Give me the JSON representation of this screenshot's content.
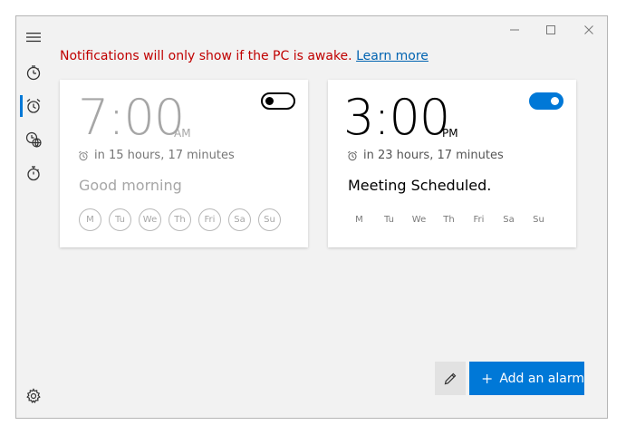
{
  "window": {
    "controls": [
      "minimize-icon",
      "maximize-icon",
      "close-icon"
    ]
  },
  "sidebar": {
    "items": [
      {
        "name": "hamburger-menu",
        "icon": "hamburger-icon"
      },
      {
        "name": "timer",
        "icon": "timer-icon"
      },
      {
        "name": "alarm",
        "icon": "alarm-clock-icon",
        "active": true
      },
      {
        "name": "world-clock",
        "icon": "world-clock-icon"
      },
      {
        "name": "stopwatch",
        "icon": "stopwatch-icon"
      },
      {
        "name": "settings",
        "icon": "gear-icon"
      }
    ]
  },
  "notice": {
    "text": "Notifications will only show if the PC is awake.",
    "link": "Learn more"
  },
  "alarms": [
    {
      "time": "7:00",
      "ampm": "AM",
      "countdown": "in 15 hours, 17 minutes",
      "name": "Good morning",
      "enabled": false,
      "days": [
        "M",
        "Tu",
        "We",
        "Th",
        "Fri",
        "Sa",
        "Su"
      ]
    },
    {
      "time": "3:00",
      "ampm": "PM",
      "countdown": "in 23 hours, 17 minutes",
      "name": "Meeting Scheduled.",
      "enabled": true,
      "days": [
        "M",
        "Tu",
        "We",
        "Th",
        "Fri",
        "Sa",
        "Su"
      ]
    }
  ],
  "footer": {
    "edit_icon": "pencil-icon",
    "add_label": "Add an alarm",
    "add_icon": "plus-icon"
  },
  "colors": {
    "accent": "#0078d7",
    "notice": "#c00000",
    "link": "#0063b1"
  }
}
